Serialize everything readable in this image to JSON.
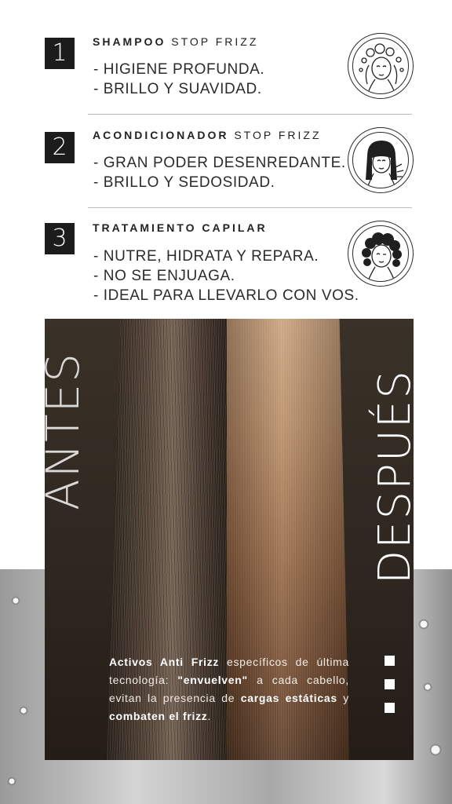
{
  "steps": [
    {
      "number": "1",
      "title_bold": "SHAMPOO",
      "title_light": "STOP FRIZZ",
      "lines": [
        "- HIGIENE PROFUNDA.",
        "- BRILLO Y SUAVIDAD."
      ],
      "icon": "woman-washing-hair-icon"
    },
    {
      "number": "2",
      "title_bold": "ACONDICIONADOR",
      "title_light": "STOP FRIZZ",
      "lines": [
        "- GRAN PODER DESENREDANTE.",
        "- BRILLO Y SEDOSIDAD."
      ],
      "icon": "woman-straight-hair-icon"
    },
    {
      "number": "3",
      "title_bold": "TRATAMIENTO CAPILAR",
      "title_light": "",
      "lines": [
        "- NUTRE, HIDRATA Y REPARA.",
        "- NO SE ENJUAGA.",
        "- IDEAL PARA LLEVARLO CON VOS."
      ],
      "icon": "woman-curly-hair-wink-icon"
    }
  ],
  "comparison": {
    "before_label": "ANTES",
    "after_label": "DESPUÉS"
  },
  "description": {
    "p1_bold": "Activos Anti Frizz",
    "p1": " específicos de última tecnología: ",
    "p2_bold": "\"envuelven\"",
    "p2": " a cada cabello, evitan la presencia de ",
    "p3_bold": "cargas estáticas",
    "p3": " y ",
    "p4_bold": "combaten el frizz",
    "p4": "."
  },
  "colors": {
    "accent_dark": "#1c1c1c",
    "text": "#2b2b2b",
    "hair_panel": "#2e261f"
  }
}
